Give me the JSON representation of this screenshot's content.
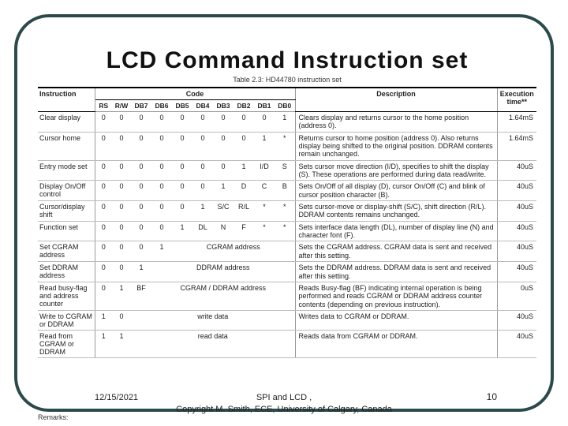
{
  "title": "LCD Command Instruction set",
  "caption": "Table 2.3: HD44780 instruction set",
  "headers": {
    "instruction": "Instruction",
    "code": "Code",
    "description": "Description",
    "time": "Execution time**",
    "bits": [
      "RS",
      "R/W",
      "DB7",
      "DB6",
      "DB5",
      "DB4",
      "DB3",
      "DB2",
      "DB1",
      "DB0"
    ]
  },
  "rows": [
    {
      "instr": "Clear display",
      "bits": [
        "0",
        "0",
        "0",
        "0",
        "0",
        "0",
        "0",
        "0",
        "0",
        "1"
      ],
      "desc": "Clears display and returns cursor to the home position (address 0).",
      "time": "1.64mS"
    },
    {
      "instr": "Cursor home",
      "bits": [
        "0",
        "0",
        "0",
        "0",
        "0",
        "0",
        "0",
        "0",
        "1",
        "*"
      ],
      "desc": "Returns cursor to home position (address 0). Also returns display being shifted to the original position. DDRAM contents remain unchanged.",
      "time": "1.64mS"
    },
    {
      "instr": "Entry mode set",
      "bits": [
        "0",
        "0",
        "0",
        "0",
        "0",
        "0",
        "0",
        "1",
        "I/D",
        "S"
      ],
      "desc": "Sets cursor move direction (I/D), specifies to shift the display (S). These operations are performed during data read/write.",
      "time": "40uS"
    },
    {
      "instr": "Display On/Off control",
      "bits": [
        "0",
        "0",
        "0",
        "0",
        "0",
        "0",
        "1",
        "D",
        "C",
        "B"
      ],
      "desc": "Sets On/Off of all display (D), cursor On/Off (C) and blink of cursor position character (B).",
      "time": "40uS"
    },
    {
      "instr": "Cursor/display shift",
      "bits": [
        "0",
        "0",
        "0",
        "0",
        "0",
        "1",
        "S/C",
        "R/L",
        "*",
        "*"
      ],
      "desc": "Sets cursor-move or display-shift (S/C), shift direction (R/L). DDRAM contents remains unchanged.",
      "time": "40uS"
    },
    {
      "instr": "Function set",
      "bits": [
        "0",
        "0",
        "0",
        "0",
        "1",
        "DL",
        "N",
        "F",
        "*",
        "*"
      ],
      "desc": "Sets interface data length (DL), number of display line (N) and character font (F).",
      "time": "40uS"
    },
    {
      "instr": "Set CGRAM address",
      "bits": [
        "0",
        "0",
        "0",
        "1"
      ],
      "span": {
        "label": "CGRAM address",
        "cols": 6
      },
      "desc": "Sets the CGRAM address. CGRAM data is sent and received after this setting.",
      "time": "40uS"
    },
    {
      "instr": "Set DDRAM address",
      "bits": [
        "0",
        "0",
        "1"
      ],
      "span": {
        "label": "DDRAM address",
        "cols": 7
      },
      "desc": "Sets the DDRAM address. DDRAM data is sent and received after this setting.",
      "time": "40uS"
    },
    {
      "instr": "Read busy-flag and address counter",
      "bits": [
        "0",
        "1",
        "BF"
      ],
      "span": {
        "label": "CGRAM / DDRAM address",
        "cols": 7
      },
      "desc": "Reads Busy-flag (BF) indicating internal operation is being performed and reads CGRAM or DDRAM address counter contents (depending on previous instruction).",
      "time": "0uS"
    },
    {
      "instr": "Write to CGRAM or DDRAM",
      "bits": [
        "1",
        "0"
      ],
      "span": {
        "label": "write data",
        "cols": 8
      },
      "desc": "Writes data to CGRAM or DDRAM.",
      "time": "40uS"
    },
    {
      "instr": "Read from CGRAM or DDRAM",
      "bits": [
        "1",
        "1"
      ],
      "span": {
        "label": "read data",
        "cols": 8
      },
      "desc": "Reads data from CGRAM or DDRAM.",
      "time": "40uS"
    }
  ],
  "remarks": "Remarks:",
  "footer": {
    "date": "12/15/2021",
    "center1": "SPI and LCD ,",
    "center2": "Copyright M. Smith, ECE, University of Calgary, Canada",
    "page": "10"
  }
}
